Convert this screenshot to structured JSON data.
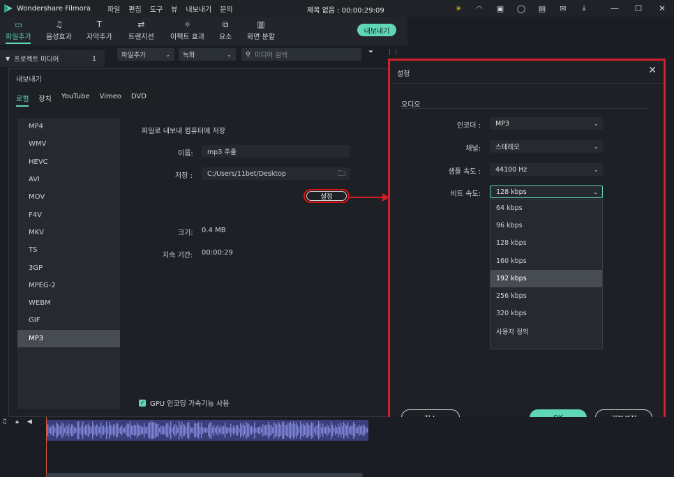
{
  "app": {
    "name": "Wondershare Filmora",
    "menu": [
      "파일",
      "편집",
      "도구",
      "뷰",
      "내보내기",
      "문의"
    ],
    "doc_title": "제목 없음 : 00:00:29:09",
    "title_icons": [
      "sun-icon",
      "headset-icon",
      "gift-icon",
      "user-icon",
      "save-icon",
      "mail-icon",
      "download-icon"
    ],
    "window_controls": [
      "minimize",
      "maximize",
      "close"
    ]
  },
  "toolbar": {
    "tools": [
      {
        "label": "파일추가",
        "icon": "folder-icon",
        "active": true
      },
      {
        "label": "음성효과",
        "icon": "music-icon",
        "active": false
      },
      {
        "label": "자막추가",
        "icon": "text-icon",
        "active": false
      },
      {
        "label": "트랜지션",
        "icon": "transition-icon",
        "active": false
      },
      {
        "label": "이펙트 효과",
        "icon": "effects-icon",
        "active": false
      },
      {
        "label": "요소",
        "icon": "elements-icon",
        "active": false
      },
      {
        "label": "화면 분할",
        "icon": "split-screen-icon",
        "active": false
      }
    ],
    "export_label": "내보내기"
  },
  "media": {
    "add_dropdown": "파일추가",
    "record_dropdown": "녹화",
    "search_placeholder": "미디어 검색",
    "project_media": "프로젝트 미디어",
    "project_count": "1"
  },
  "export_dialog": {
    "title": "내보내기",
    "tabs": [
      "로컬",
      "장치",
      "YouTube",
      "Vimeo",
      "DVD"
    ],
    "formats": [
      "MP4",
      "WMV",
      "HEVC",
      "AVI",
      "MOV",
      "F4V",
      "MKV",
      "TS",
      "3GP",
      "MPEG-2",
      "WEBM",
      "GIF",
      "MP3"
    ],
    "selected_format": "MP3",
    "section_title": "파일로 내보내 컴퓨터에 저장",
    "name_label": "이름:",
    "name_value": "mp3 추출",
    "save_label": "저장 :",
    "save_value": "C:/Users/11bet/Desktop",
    "settings_button": "설정",
    "size_label": "크기:",
    "size_value": "0.4 MB",
    "duration_label": "지속 기간:",
    "duration_value": "00:00:29",
    "gpu_label": "GPU 인코딩 가속기능 사용"
  },
  "settings_dialog": {
    "title": "설정",
    "section": "오디오",
    "encoder_label": "인코더 :",
    "encoder_value": "MP3",
    "channel_label": "채널:",
    "channel_value": "스테레오",
    "sample_rate_label": "샘플 속도 :",
    "sample_rate_value": "44100 Hz",
    "bitrate_label": "비트 속도:",
    "bitrate_value": "128 kbps",
    "bitrate_options": [
      "64 kbps",
      "96 kbps",
      "128 kbps",
      "160 kbps",
      "192 kbps",
      "256 kbps",
      "320 kbps",
      "사용자 정의"
    ],
    "highlighted_option": "192 kbps",
    "cancel_label": "취소",
    "ok_label": "OK",
    "default_label": "기본설정"
  },
  "colors": {
    "accent": "#5fd6b8",
    "highlight_red": "#d21f2a",
    "waveform": "#5a5fb0"
  }
}
